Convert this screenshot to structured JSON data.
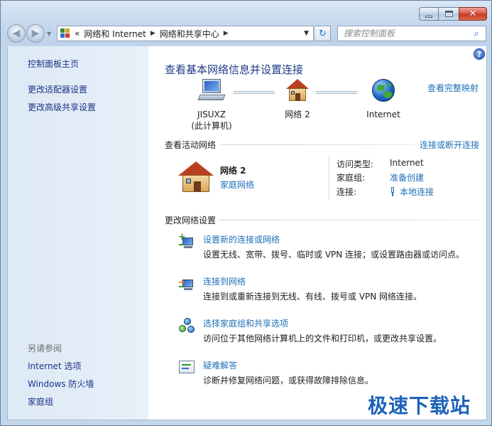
{
  "window": {
    "caption_min": "—",
    "caption_max": "",
    "caption_close": "✕"
  },
  "address": {
    "chevrons": "«",
    "crumbs": [
      "网络和 Internet",
      "网络和共享中心"
    ],
    "arrow": "▶",
    "dropdown": "▼",
    "refresh": "↻",
    "back": "◀",
    "forward": "▶",
    "nav_dropdown": "▼"
  },
  "search": {
    "placeholder": "搜索控制面板",
    "icon": "magnifier-icon"
  },
  "sidebar": {
    "home": "控制面板主页",
    "links": [
      "更改适配器设置",
      "更改高级共享设置"
    ],
    "see_also_heading": "另请参阅",
    "see_also": [
      "Internet 选项",
      "Windows 防火墙",
      "家庭组"
    ]
  },
  "main": {
    "help": "?",
    "title": "查看基本网络信息并设置连接",
    "full_map_link": "查看完整映射",
    "map": {
      "computer_name": "JISUXZ",
      "computer_sub": "(此计算机)",
      "network_label": "网络  2",
      "internet_label": "Internet"
    },
    "active_networks": {
      "heading": "查看活动网络",
      "toggle_link": "连接或断开连接",
      "name": "网络  2",
      "type": "家庭网络",
      "props": [
        {
          "label": "访问类型:",
          "value": "Internet"
        },
        {
          "label": "家庭组:",
          "value": "准备创建"
        },
        {
          "label": "连接:",
          "value": "本地连接"
        }
      ]
    },
    "change_settings": {
      "heading": "更改网络设置",
      "tasks": [
        {
          "link": "设置新的连接或网络",
          "desc": "设置无线、宽带、拨号、临时或 VPN 连接；或设置路由器或访问点。"
        },
        {
          "link": "连接到网络",
          "desc": "连接到或重新连接到无线、有线、拨号或 VPN 网络连接。"
        },
        {
          "link": "选择家庭组和共享选项",
          "desc": "访问位于其他网络计算机上的文件和打印机，或更改共享设置。"
        },
        {
          "link": "疑难解答",
          "desc": "诊断并修复网络问题，或获得故障排除信息。"
        }
      ]
    }
  },
  "watermark": "极速下载站"
}
